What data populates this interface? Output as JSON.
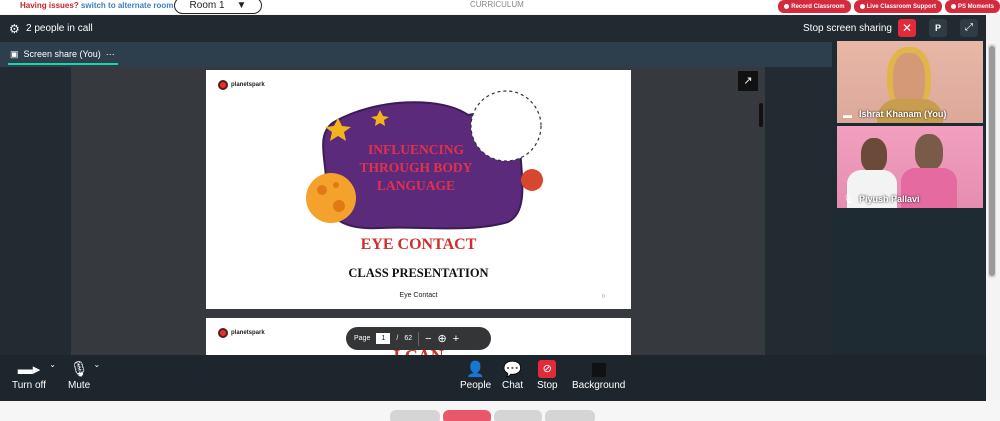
{
  "top": {
    "issues_text": "Having issues?",
    "alt_link": "switch to alternate room",
    "room_label": "Room 1",
    "curriculum": "CURRICULUM",
    "buttons": [
      "Record Classroom",
      "Live Classroom Support",
      "PS Moments"
    ]
  },
  "header": {
    "people_count": "2 people in call",
    "stop_share_label": "Stop screen sharing",
    "p_button": "P"
  },
  "tab": {
    "label": "Screen share (You)"
  },
  "slide": {
    "logo": "planetspark",
    "title_lines": [
      "INFLUENCING",
      "THROUGH BODY",
      "LANGUAGE"
    ],
    "subtitle": "EYE CONTACT",
    "presentation": "CLASS PRESENTATION",
    "footer": "Eye Contact",
    "slide2_title": "I CAN"
  },
  "pdf": {
    "page_label": "Page",
    "current": "1",
    "separator": "/",
    "total": "62"
  },
  "participants": [
    {
      "name": "Ishrat Khanam (You)"
    },
    {
      "name": "Piyush Pallavi"
    }
  ],
  "controls": {
    "turn_off": "Turn off",
    "mute": "Mute",
    "people": "People",
    "chat": "Chat",
    "stop": "Stop",
    "background": "Background"
  },
  "colors": {
    "accent_red": "#e12b3a",
    "tab_underline": "#24d0a4",
    "title_color": "#e0324c"
  }
}
